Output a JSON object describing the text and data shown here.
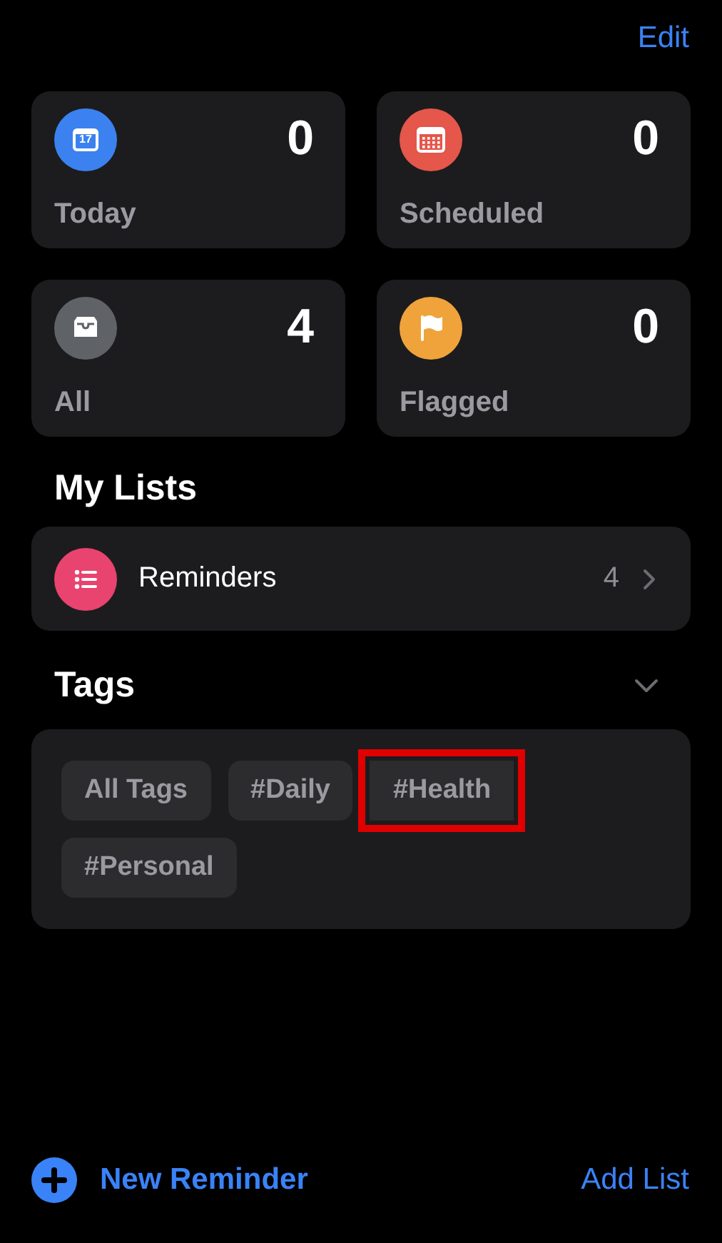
{
  "nav": {
    "edit": "Edit"
  },
  "smart_lists": [
    {
      "label": "Today",
      "count": "0",
      "kind": "today",
      "color": "#3b82f0",
      "icon_text": "17"
    },
    {
      "label": "Scheduled",
      "count": "0",
      "kind": "scheduled",
      "color": "#e5564b"
    },
    {
      "label": "All",
      "count": "4",
      "kind": "all",
      "color": "#5f6368"
    },
    {
      "label": "Flagged",
      "count": "0",
      "kind": "flagged",
      "color": "#f0a33a"
    }
  ],
  "my_lists": {
    "title": "My Lists",
    "items": [
      {
        "name": "Reminders",
        "count": "4",
        "color": "#e9436f"
      }
    ]
  },
  "tags": {
    "title": "Tags",
    "expanded": true,
    "items": [
      {
        "label": "All Tags",
        "highlighted": false
      },
      {
        "label": "#Daily",
        "highlighted": false
      },
      {
        "label": "#Health",
        "highlighted": true
      },
      {
        "label": "#Personal",
        "highlighted": false
      }
    ]
  },
  "toolbar": {
    "new_reminder": "New Reminder",
    "add_list": "Add List"
  }
}
